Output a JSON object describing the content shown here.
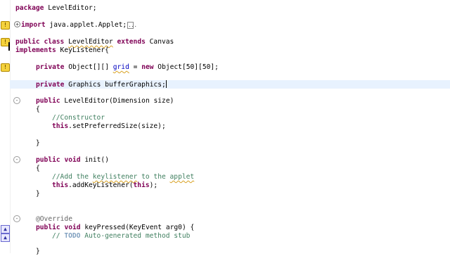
{
  "editor": {
    "lines": {
      "l1": {
        "kw": "package",
        "rest": " LevelEditor;"
      },
      "l2": {
        "kw": "import",
        "rest": " java.applet.Applet;",
        "fold_label": "..."
      },
      "l3": {
        "kw1": "public",
        "kw2": "class",
        "name": "LevelEditor",
        "kw3": "extends",
        "rest": " Canvas"
      },
      "l4": {
        "kw": "implements",
        "rest": " KeyListener{"
      },
      "l5": {
        "kw": "private",
        "mid": " Object[][] ",
        "field": "grid",
        "eq": " = ",
        "kw2": "new",
        "rest": " Object[50][50];"
      },
      "l6": {
        "kw": "private",
        "rest": " Graphics bufferGraphics;"
      },
      "l7": {
        "kw": "public",
        "rest": " LevelEditor(Dimension size)"
      },
      "l8": {
        "text": "{"
      },
      "l9": {
        "comment": "//Constructor"
      },
      "l10": {
        "kw": "this",
        "rest": ".setPreferredSize(size);"
      },
      "l11": {
        "text": "}"
      },
      "l12": {
        "kw": "public",
        "kw2": "void",
        "rest": " init()"
      },
      "l13": {
        "text": "{"
      },
      "l14": {
        "c1": "//Add the ",
        "c2": "keylistener",
        "c3": " to the ",
        "c4": "applet"
      },
      "l15": {
        "kw": "this",
        "rest": ".addKeyListener(",
        "kw2": "this",
        "rest2": ");"
      },
      "l16": {
        "text": "}"
      },
      "l17": {
        "annotation": "@Override"
      },
      "l18": {
        "kw": "public",
        "kw2": "void",
        "rest": " keyPressed(KeyEvent arg0) {"
      },
      "l19": {
        "c1": "// ",
        "todo": "TODO",
        "c2": " Auto-generated method stub"
      },
      "l20": {
        "text": "}"
      }
    },
    "gutter": {
      "fold_expand": "+",
      "fold_collapse": "-",
      "warning": "!",
      "override": "▲"
    }
  }
}
